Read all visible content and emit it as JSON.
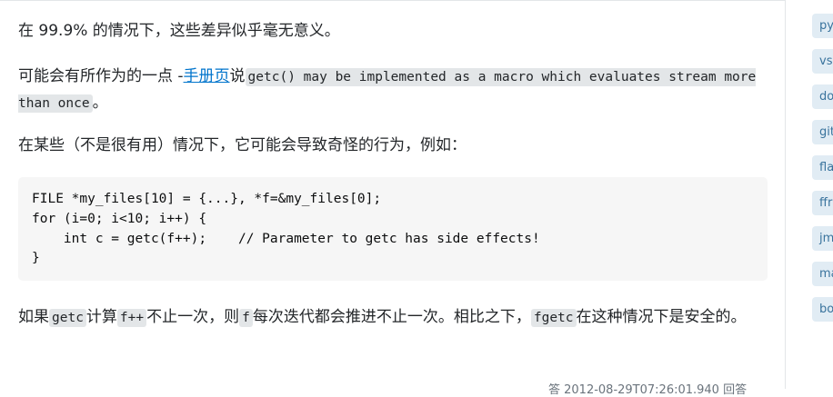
{
  "answer": {
    "p1": "在 99.9% 的情况下，这些差异似乎毫无意义。",
    "p2_prefix": "可能会有所作为的一点 -",
    "p2_link": "手册页",
    "p2_mid": "说",
    "p2_code": "getc() may be implemented as a macro which evaluates stream more than once",
    "p2_suffix": "。",
    "p3": "在某些（不是很有用）情况下，它可能会导致奇怪的行为，例如：",
    "code_block": "FILE *my_files[10] = {...}, *f=&my_files[0];\nfor (i=0; i<10; i++) {\n    int c = getc(f++);    // Parameter to getc has side effects!\n}",
    "p4_a": "如果",
    "p4_code1": "getc",
    "p4_b": "计算",
    "p4_code2": "f++",
    "p4_c": "不止一次，则",
    "p4_code3": "f",
    "p4_d": "每次迭代都会推进不止一次。相比之下，",
    "p4_code4": "fgetc",
    "p4_e": "在这种情况下是安全的。",
    "meta": "答 2012-08-29T07:26:01.940 回答"
  },
  "sidebar": {
    "tags": [
      "py",
      "vs",
      "do",
      "git",
      "fla",
      "ffr",
      "jm",
      "ma",
      "bo"
    ]
  }
}
